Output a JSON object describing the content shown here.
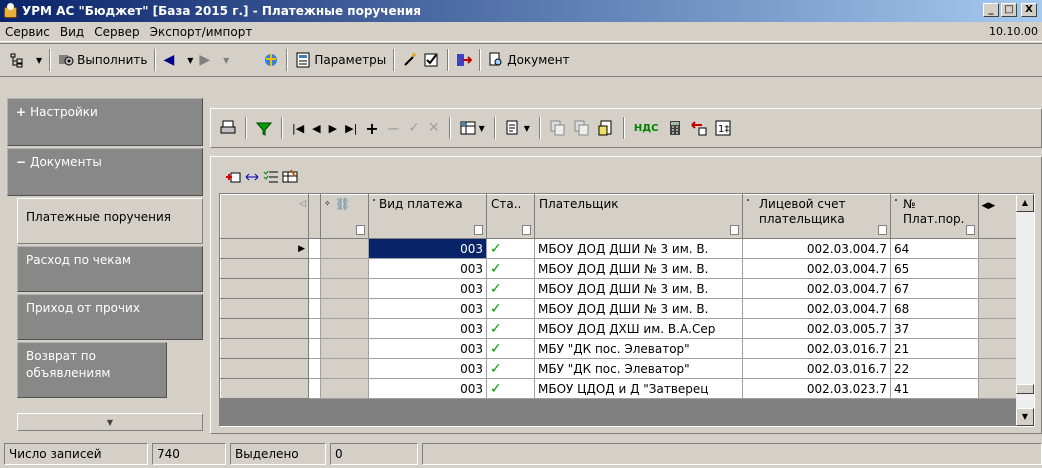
{
  "window": {
    "title": "УРМ АС \"Бюджет\" [База 2015 г.] - Платежные поручения",
    "minimize": "_",
    "restore": "□",
    "close": "X"
  },
  "menu": {
    "items": [
      "Сервис",
      "Вид",
      "Сервер",
      "Экспорт/импорт"
    ],
    "date": "10.10.00"
  },
  "toolbar1": {
    "run_label": "Выполнить",
    "params_label": "Параметры",
    "doc_label": "Документ"
  },
  "sidebar": {
    "settings_label": "Настройки",
    "documents_label": "Документы",
    "items": [
      {
        "label": "Платежные поручения",
        "active": true
      },
      {
        "label": "Расход по чекам"
      },
      {
        "label": "Приход от прочих"
      },
      {
        "label": "Возврат по объявлениям"
      }
    ]
  },
  "toolbar2": {
    "nds_label": "НДС"
  },
  "grid": {
    "columns": [
      "Вид платежа",
      "Ста..",
      "Плательщик",
      "Лицевой счет плательщика",
      "№ Плат.пор."
    ],
    "rows": [
      {
        "type": "003",
        "payer": "МБОУ ДОД ДШИ № 3 им. В.",
        "account": "002.03.004.7",
        "num": "64",
        "selected": true
      },
      {
        "type": "003",
        "payer": "МБОУ ДОД ДШИ № 3 им. В.",
        "account": "002.03.004.7",
        "num": "65"
      },
      {
        "type": "003",
        "payer": "МБОУ ДОД ДШИ № 3 им. В.",
        "account": "002.03.004.7",
        "num": "67"
      },
      {
        "type": "003",
        "payer": "МБОУ ДОД ДШИ № 3 им. В.",
        "account": "002.03.004.7",
        "num": "68"
      },
      {
        "type": "003",
        "payer": "МБОУ ДОД ДХШ им. В.А.Сер",
        "account": "002.03.005.7",
        "num": "37"
      },
      {
        "type": "003",
        "payer": "МБУ \"ДК пос. Элеватор\"",
        "account": "002.03.016.7",
        "num": "21"
      },
      {
        "type": "003",
        "payer": "МБУ \"ДК пос. Элеватор\"",
        "account": "002.03.016.7",
        "num": "22"
      },
      {
        "type": "003",
        "payer": "МБОУ ЦДОД и Д \"Затверец",
        "account": "002.03.023.7",
        "num": "41"
      }
    ],
    "status_check": "✓"
  },
  "status": {
    "count_label": "Число записей",
    "count_value": "740",
    "selected_label": "Выделено",
    "selected_value": "0"
  }
}
